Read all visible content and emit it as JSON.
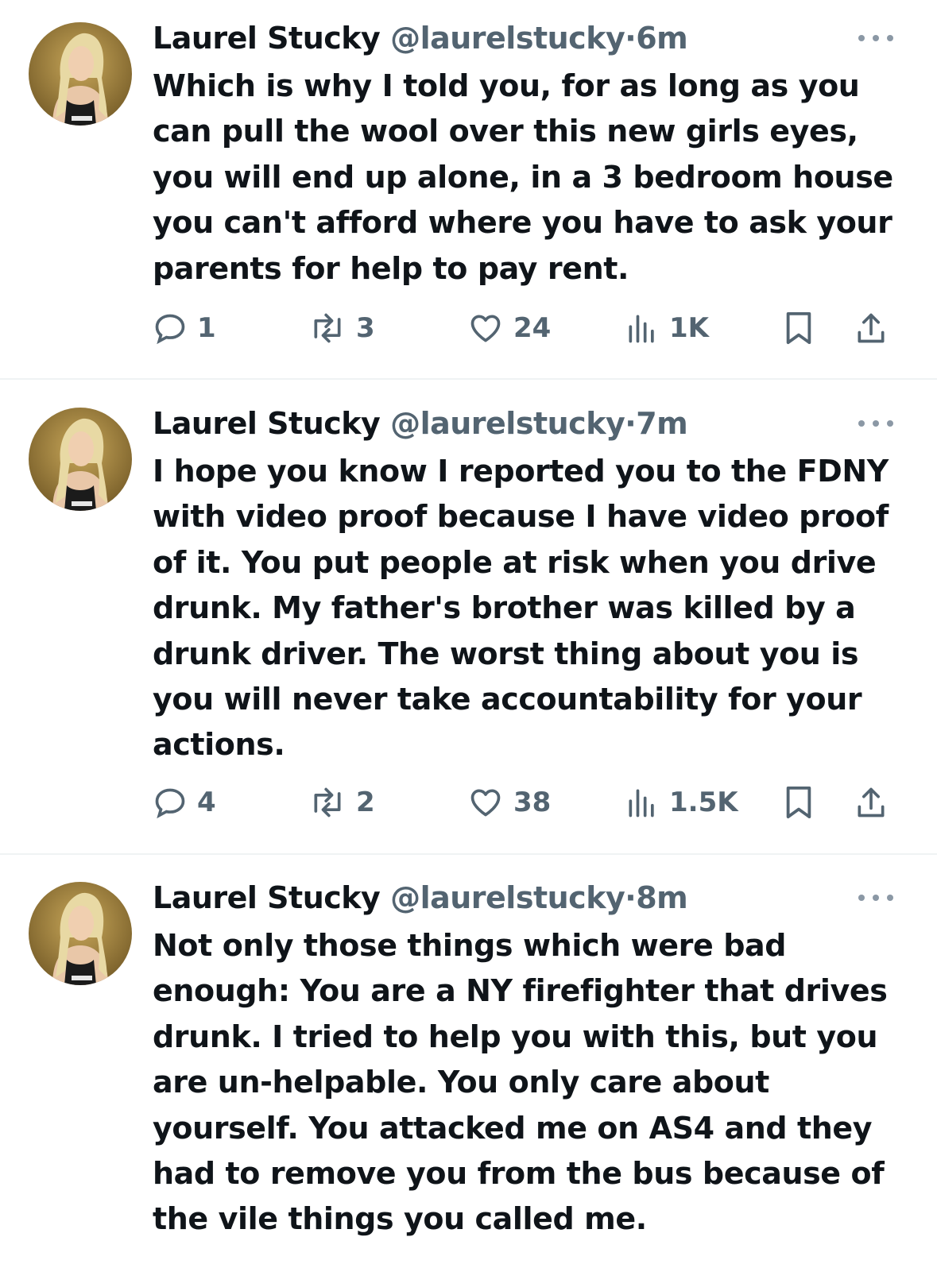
{
  "tweets": [
    {
      "author_name": "Laurel Stucky",
      "handle": "@laurelstucky",
      "separator": "·",
      "time": "6m",
      "avatar_icon": "profile-photo",
      "text": "Which is why I told you, for as long as you can pull the wool over this new girls eyes, you will end up alone, in a 3 bedroom house you can't afford where you have to ask your parents for help to pay rent.",
      "replies": "1",
      "reposts": "3",
      "likes": "24",
      "views": "1K"
    },
    {
      "author_name": "Laurel Stucky",
      "handle": "@laurelstucky",
      "separator": "·",
      "time": "7m",
      "avatar_icon": "profile-photo",
      "text": "I hope you know I reported you to the FDNY with video proof because I have video proof of it. You put people at risk when you drive drunk. My father's brother was killed by a drunk driver. The worst thing about you is you will never take accountability for your actions.",
      "replies": "4",
      "reposts": "2",
      "likes": "38",
      "views": "1.5K"
    },
    {
      "author_name": "Laurel Stucky",
      "handle": "@laurelstucky",
      "separator": "·",
      "time": "8m",
      "avatar_icon": "profile-photo",
      "text": "Not only those things which were bad enough: You are a NY firefighter that drives drunk. I tried to help you with this, but you are un-helpable. You only care about yourself. You attacked me on AS4 and they had to remove you from the bus because of the vile things you called me."
    }
  ],
  "colors": {
    "text": "#0f1419",
    "secondary": "#536471",
    "divider": "#eff3f4"
  }
}
